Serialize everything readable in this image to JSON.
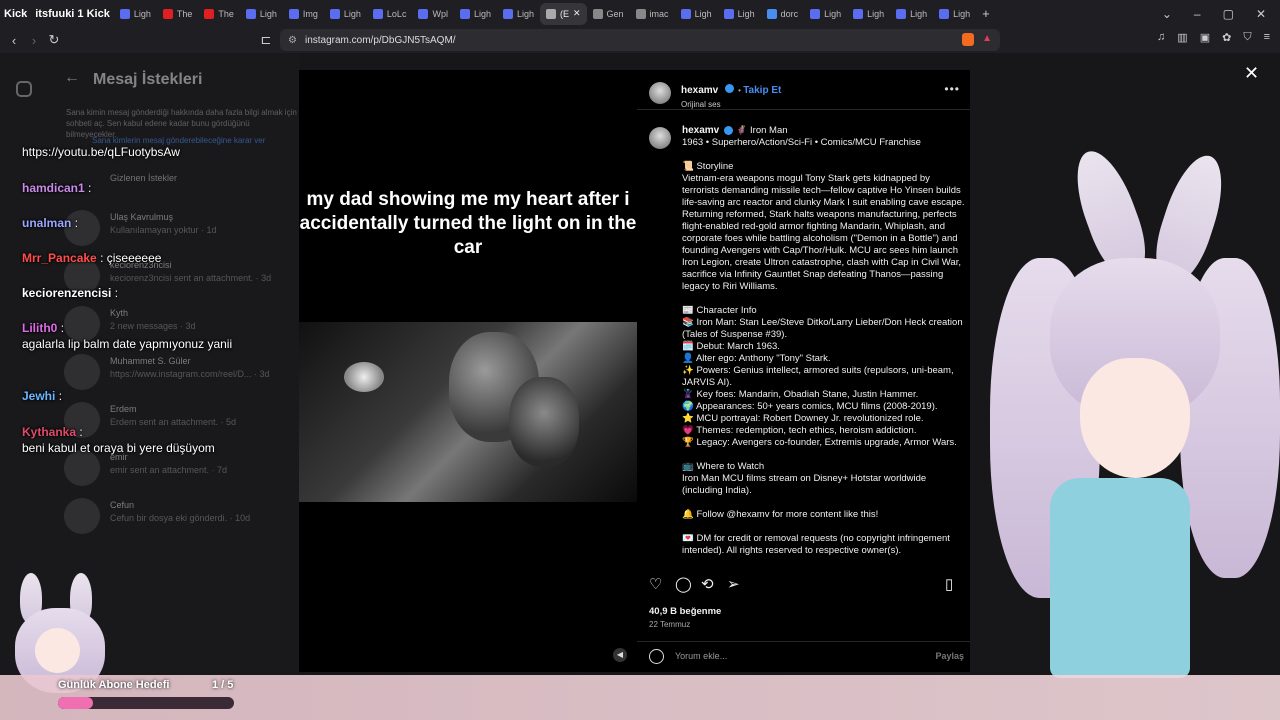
{
  "browser": {
    "tabs": [
      {
        "label": "Ligh",
        "icon": "page-icon"
      },
      {
        "label": "The",
        "icon": "youtube-icon"
      },
      {
        "label": "The",
        "icon": "youtube-icon"
      },
      {
        "label": "Ligh",
        "icon": "page-icon"
      },
      {
        "label": "Img",
        "icon": "page-icon"
      },
      {
        "label": "Ligh",
        "icon": "page-icon"
      },
      {
        "label": "LoLc",
        "icon": "page-icon"
      },
      {
        "label": "Wpl",
        "icon": "page-icon"
      },
      {
        "label": "Ligh",
        "icon": "page-icon"
      },
      {
        "label": "Ligh",
        "icon": "page-icon"
      },
      {
        "label": "(E",
        "icon": "audio-icon",
        "active": true
      },
      {
        "label": "Gen",
        "icon": "globe-icon"
      },
      {
        "label": "imac",
        "icon": "globe-icon"
      },
      {
        "label": "Ligh",
        "icon": "page-icon"
      },
      {
        "label": "Ligh",
        "icon": "page-icon"
      },
      {
        "label": "dorc",
        "icon": "google-icon"
      },
      {
        "label": "Ligh",
        "icon": "page-icon"
      },
      {
        "label": "Ligh",
        "icon": "page-icon"
      },
      {
        "label": "Ligh",
        "icon": "page-icon"
      },
      {
        "label": "Ligh",
        "icon": "page-icon"
      }
    ],
    "kick_label": "itsfuuki 1 Kick",
    "kick_prefix": "Kick",
    "url": "instagram.com/p/DbGJN5TsAQM/"
  },
  "dm_panel": {
    "title": "Mesaj İstekleri",
    "description": "Sana kimin mesaj gönderdiği hakkında daha fazla bilgi almak için sohbeti aç. Sen kabul edene kadar bunu gördüğünü bilmeyecekler.",
    "link": "Sana kimlerin mesaj gönderebileceğine karar ver",
    "hidden_requests": "Gizlenen İstekler",
    "rows": [
      {
        "name": "Ulaş Kavrulmuş",
        "message": "Kullanılamayan yoktur · 1d"
      },
      {
        "name": "keciorenz3ncisi",
        "message": "keciorenz3ncisi sent an attachment. · 3d"
      },
      {
        "name": "Kyth",
        "message": "2 new messages · 3d"
      },
      {
        "name": "Muhammet S. Güler",
        "message": "https://www.instagram.com/reel/D... · 3d"
      },
      {
        "name": "Erdem",
        "message": "Erdem sent an attachment. · 5d"
      },
      {
        "name": "emir",
        "message": "emir sent an attachment. · 7d"
      },
      {
        "name": "Cefun",
        "message": "Cefun bir dosya eki gönderdi. · 10d"
      }
    ]
  },
  "chat": [
    {
      "name": "",
      "text": "https://youtu.be/qLFuotybsAw",
      "color": "#ffffff"
    },
    {
      "name": "hamdican1",
      "text": ":",
      "color": "#c98be8"
    },
    {
      "name": "unalman",
      "text": ":",
      "color": "#9aa6ff"
    },
    {
      "name": "Mrr_Pancake",
      "text": ": çiseeeeee",
      "color": "#ff4d4d"
    },
    {
      "name": "keciorenzencisi",
      "text": ":",
      "color": "#ffffff"
    },
    {
      "name": "Lilith0",
      "text": ":",
      "color": "#e06be8"
    },
    {
      "name": "",
      "text": "agalarla lip balm date yapmıyonuz yanii",
      "color": "#ffffff"
    },
    {
      "name": "Jewhi",
      "text": ":",
      "color": "#6ab7ff"
    },
    {
      "name": "Kythanka",
      "text": ":",
      "color": "#e04a6a"
    },
    {
      "name": "",
      "text": "beni kabul et oraya bi yere düşüyom",
      "color": "#ffffff"
    }
  ],
  "post": {
    "overlay_text": "my dad showing me my heart after i accidentally turned the light on in the car",
    "author": "hexamv",
    "follow_label": "Takip Et",
    "audio_label": "Orijinal ses",
    "caption_head": "Iron Man",
    "caption_sub": "1963 • Superhero/Action/Sci-Fi • Comics/MCU Franchise",
    "caption_body": "📜 Storyline\nVietnam-era weapons mogul Tony Stark gets kidnapped by terrorists demanding missile tech—fellow captive Ho Yinsen builds life-saving arc reactor and clunky Mark I suit enabling cave escape. Returning reformed, Stark halts weapons manufacturing, perfects flight-enabled red-gold armor fighting Mandarin, Whiplash, and corporate foes while battling alcoholism (\"Demon in a Bottle\") and founding Avengers with Cap/Thor/Hulk. MCU arc sees him launch Iron Legion, create Ultron catastrophe, clash with Cap in Civil War, sacrifice via Infinity Gauntlet Snap defeating Thanos—passing legacy to Riri Williams.\n\n📰 Character Info\n📚 Iron Man: Stan Lee/Steve Ditko/Larry Lieber/Don Heck creation (Tales of Suspense #39).\n🗓️ Debut: March 1963.\n👤 Alter ego: Anthony \"Tony\" Stark.\n✨ Powers: Genius intellect, armored suits (repulsors, uni-beam, JARVIS AI).\n🦹 Key foes: Mandarin, Obadiah Stane, Justin Hammer.\n🌍 Appearances: 50+ years comics, MCU films (2008-2019).\n⭐ MCU portrayal: Robert Downey Jr. revolutionized role.\n💗 Themes: redemption, tech ethics, heroism addiction.\n🏆 Legacy: Avengers co-founder, Extremis upgrade, Armor Wars.\n\n📺 Where to Watch\nIron Man MCU films stream on Disney+ Hotstar worldwide (including India).\n\n🔔 Follow @hexamv for more content like this!\n\n💌 DM for credit or removal requests (no copyright infringement intended). All rights reserved to respective owner(s).",
    "likes": "40,9 B beğenme",
    "date": "22 Temmuz",
    "comment_placeholder": "Yorum ekle...",
    "share_label": "Paylaş"
  },
  "stream_goal": {
    "label": "Günlük Abone Hedefi",
    "count": "1 / 5",
    "progress": 0.2
  }
}
